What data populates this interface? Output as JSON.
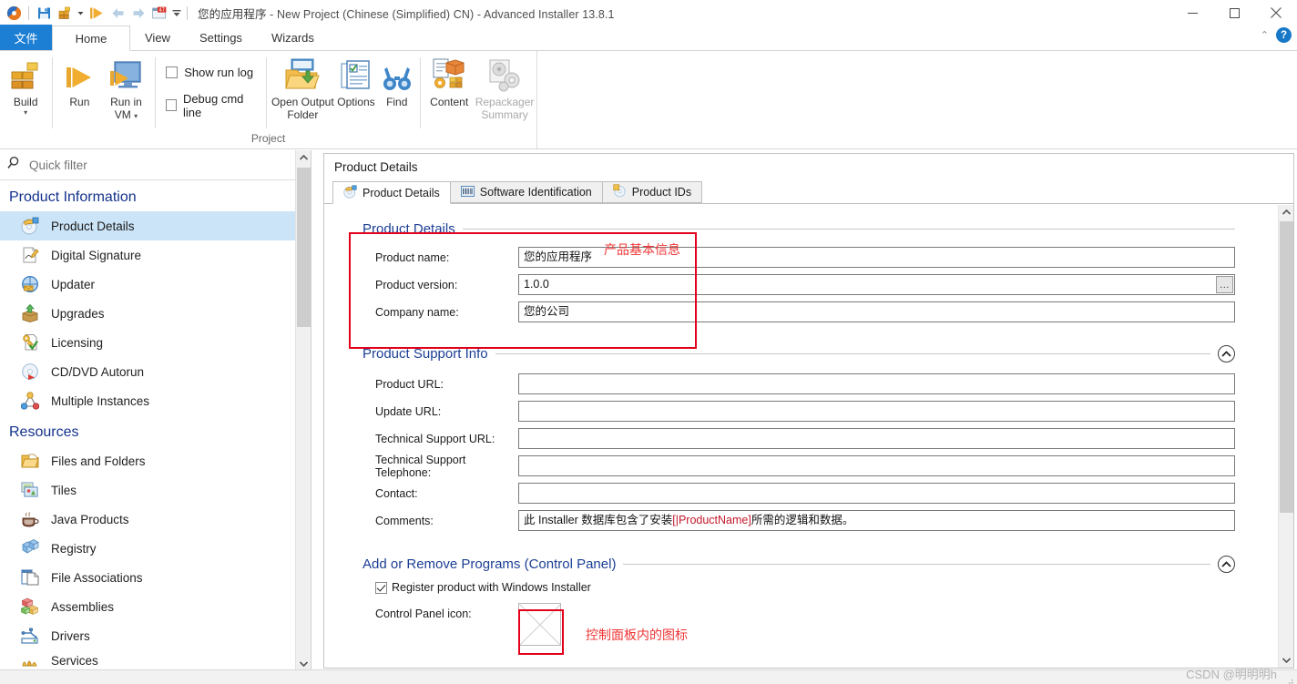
{
  "window": {
    "title_app": "您的应用程序",
    "title_rest": " - New Project (Chinese (Simplified) CN) - Advanced Installer 13.8.1",
    "minimize": "—",
    "maximize": "□",
    "close": "✕"
  },
  "quick_access": [
    {
      "name": "app-logo-icon"
    },
    {
      "name": "save-icon"
    },
    {
      "name": "build-icon"
    },
    {
      "name": "build-dropdown-icon"
    },
    {
      "name": "run-icon"
    },
    {
      "name": "back-icon"
    },
    {
      "name": "forward-icon"
    },
    {
      "name": "calendar-47-icon",
      "badge": "47"
    },
    {
      "name": "customize-qat-icon"
    }
  ],
  "ribbon": {
    "tabs": [
      {
        "label": "文件",
        "id": "file",
        "state": "file"
      },
      {
        "label": "Home",
        "id": "home",
        "state": "active"
      },
      {
        "label": "View",
        "id": "view",
        "state": "normal"
      },
      {
        "label": "Settings",
        "id": "settings",
        "state": "normal"
      },
      {
        "label": "Wizards",
        "id": "wizards",
        "state": "normal"
      }
    ],
    "collapse_caret": "⌃",
    "help_label": "?",
    "group_label": "Project",
    "buttons": {
      "build": "Build",
      "build_caret": "▾",
      "run": "Run",
      "run_in_vm_line1": "Run in",
      "run_in_vm_line2": "VM",
      "run_in_vm_caret": "▾",
      "show_run_log": "Show run log",
      "debug_cmd_line": "Debug cmd line",
      "open_output_folder_line1": "Open Output",
      "open_output_folder_line2": "Folder",
      "options": "Options",
      "find": "Find",
      "content": "Content",
      "repackager_line1": "Repackager",
      "repackager_line2": "Summary"
    },
    "checkbox_states": {
      "show_run_log": false,
      "debug_cmd_line": false
    }
  },
  "sidebar": {
    "filter_placeholder": "Quick filter",
    "filter_value": "",
    "search_icon": "search-icon",
    "sections": [
      {
        "title": "Product Information",
        "items": [
          {
            "label": "Product Details",
            "icon": "product-details-icon",
            "selected": true
          },
          {
            "label": "Digital Signature",
            "icon": "digital-signature-icon",
            "selected": false
          },
          {
            "label": "Updater",
            "icon": "updater-icon",
            "selected": false
          },
          {
            "label": "Upgrades",
            "icon": "upgrades-icon",
            "selected": false
          },
          {
            "label": "Licensing",
            "icon": "licensing-icon",
            "selected": false
          },
          {
            "label": "CD/DVD Autorun",
            "icon": "cd-dvd-autorun-icon",
            "selected": false
          },
          {
            "label": "Multiple Instances",
            "icon": "multiple-instances-icon",
            "selected": false
          }
        ]
      },
      {
        "title": "Resources",
        "items": [
          {
            "label": "Files and Folders",
            "icon": "folder-icon",
            "selected": false
          },
          {
            "label": "Tiles",
            "icon": "tiles-icon",
            "selected": false
          },
          {
            "label": "Java Products",
            "icon": "java-icon",
            "selected": false
          },
          {
            "label": "Registry",
            "icon": "registry-icon",
            "selected": false
          },
          {
            "label": "File Associations",
            "icon": "file-associations-icon",
            "selected": false
          },
          {
            "label": "Assemblies",
            "icon": "assemblies-icon",
            "selected": false
          },
          {
            "label": "Drivers",
            "icon": "drivers-icon",
            "selected": false
          },
          {
            "label": "Services",
            "icon": "services-icon",
            "selected": false
          }
        ]
      }
    ]
  },
  "main": {
    "header_title": "Product Details",
    "tabs": [
      {
        "label": "Product Details",
        "icon": "product-details-icon",
        "active": true
      },
      {
        "label": "Software Identification",
        "icon": "barcode-icon",
        "active": false
      },
      {
        "label": "Product IDs",
        "icon": "product-ids-icon",
        "active": false
      }
    ],
    "groups": {
      "product_details": {
        "title": "Product Details",
        "fields": [
          {
            "label": "Product name:",
            "value": "您的应用程序",
            "browse": false
          },
          {
            "label": "Product version:",
            "value": "1.0.0",
            "browse": true,
            "browse_label": "..."
          },
          {
            "label": "Company name:",
            "value": "您的公司",
            "browse": false
          }
        ]
      },
      "product_support_info": {
        "title": "Product Support Info",
        "toggle": "⌃",
        "fields": [
          {
            "label": "Product URL:",
            "value": ""
          },
          {
            "label": "Update URL:",
            "value": ""
          },
          {
            "label": "Technical Support URL:",
            "value": ""
          },
          {
            "label": "Technical Support Telephone:",
            "value": ""
          },
          {
            "label": "Contact:",
            "value": ""
          },
          {
            "label": "Comments:",
            "value": "",
            "rich": [
              {
                "t": "此 Installer 数据库包含了安装 ",
                "c": "normal"
              },
              {
                "t": "[|ProductName]",
                "c": "red"
              },
              {
                "t": " 所需的逻辑和数据。",
                "c": "normal"
              }
            ]
          }
        ]
      },
      "add_remove_programs": {
        "title": "Add or Remove Programs (Control Panel)",
        "toggle": "⌃",
        "register_checkbox_label": "Register product with Windows Installer",
        "register_checked": true,
        "control_panel_icon_label": "Control Panel icon:"
      }
    }
  },
  "annotations": [
    {
      "id": "product-details-box",
      "text": "产品基本信息",
      "color": "#ef3535"
    },
    {
      "id": "control-panel-icon-note",
      "text": "控制面板内的图标",
      "color": "#ef3535"
    }
  ],
  "statusbar": {
    "watermark": "CSDN @明明明h"
  }
}
